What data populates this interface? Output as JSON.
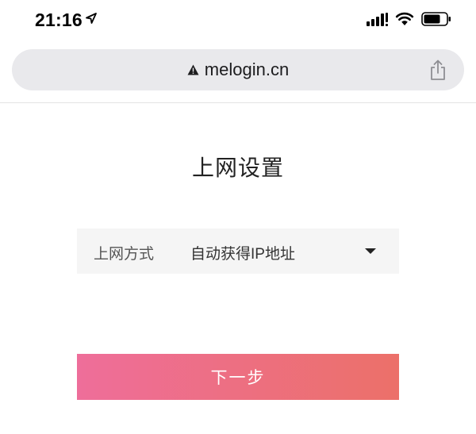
{
  "status_bar": {
    "time": "21:16",
    "icons": [
      "location-arrow-icon",
      "cellular-signal-icon",
      "wifi-icon",
      "battery-icon"
    ]
  },
  "address_bar": {
    "url": "melogin.cn",
    "warning_icon": "warning-triangle-icon",
    "share_icon": "share-icon"
  },
  "page": {
    "title": "上网设置"
  },
  "connection": {
    "label": "上网方式",
    "selected_value": "自动获得IP地址",
    "arrow_icon": "dropdown-triangle-icon"
  },
  "actions": {
    "next_label": "下一步"
  },
  "colors": {
    "button_gradient_start": "#ee6e9a",
    "button_gradient_end": "#ec7069",
    "address_bar_bg": "#e9e9ec",
    "select_bg": "#f5f5f5"
  }
}
